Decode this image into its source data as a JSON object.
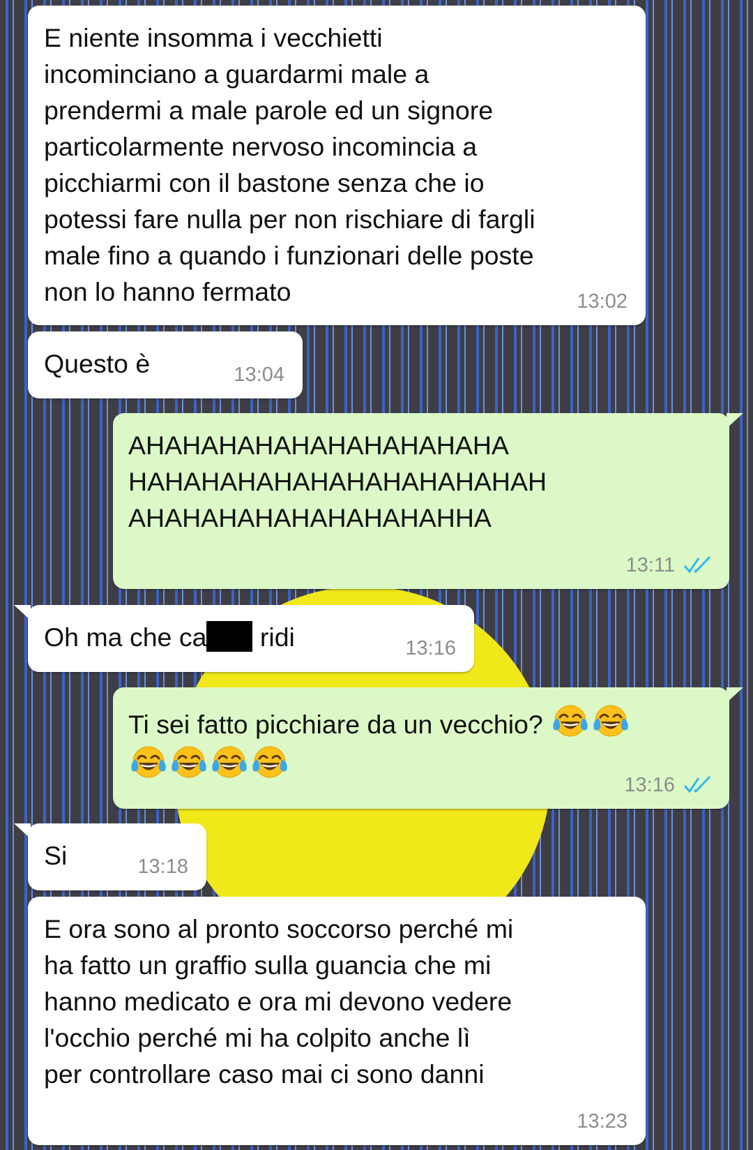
{
  "messages": [
    {
      "id": 1,
      "direction": "incoming",
      "text": "E niente insomma i vecchietti\nincominciano a guardarmi male a\nprendermi a male parole ed un signore\nparticolarmente nervoso incomincia a\npicchiarmi con il bastone senza che io\npotessi fare nulla per non rischiare di fargli\nmale fino a quando i funzionari delle poste\nnon lo hanno fermato",
      "time": "13:02"
    },
    {
      "id": 2,
      "direction": "incoming",
      "text": "Questo è",
      "time": "13:04"
    },
    {
      "id": 3,
      "direction": "outgoing",
      "text": "AHAHAHAHAHAHAHAHAHAHA\nHAHAHAHAHAHAHAHAHAHAHAH\nAHAHAHAHAHAHAHAHAHHA",
      "time": "13:11",
      "status": "read"
    },
    {
      "id": 4,
      "direction": "incoming",
      "text_before": "Oh ma che ca",
      "text_after": " ridi",
      "redacted": true,
      "time": "13:16"
    },
    {
      "id": 5,
      "direction": "outgoing",
      "text": "Ti sei fatto picchiare da un vecchio?",
      "emoji": "face-with-tears-of-joy",
      "emoji_count": 6,
      "time": "13:16",
      "status": "read"
    },
    {
      "id": 6,
      "direction": "incoming",
      "text": "Si",
      "time": "13:18"
    },
    {
      "id": 7,
      "direction": "incoming",
      "text": "E ora sono al pronto soccorso perché mi\nha fatto un graffio sulla guancia che mi\nhanno medicato e ora mi devono vedere\nl'occhio perché mi ha colpito anche lì\nper controllare caso mai ci sono danni",
      "time": "13:23"
    }
  ],
  "colors": {
    "incoming_bubble": "#ffffff",
    "outgoing_bubble": "#dcf8c6",
    "read_check": "#34b7f1",
    "timestamp": "#8c8c8c",
    "wallpaper_bg": "#3e3e44",
    "wallpaper_stripe": "#3b63c8",
    "umbrella": "#f1e81a"
  }
}
